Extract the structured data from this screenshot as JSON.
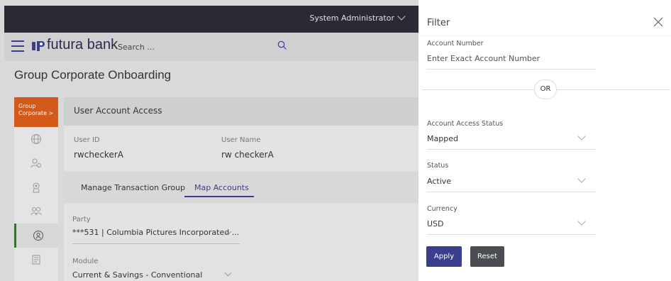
{
  "topbar": {
    "user_label": "System Administrator"
  },
  "header": {
    "brand": "futura bank",
    "search_placeholder": "Search ..."
  },
  "page": {
    "title": "Group Corporate Onboarding"
  },
  "leftnav": {
    "group_label_line1": "Group",
    "group_label_line2": "Corporate",
    "group_chevron": ">"
  },
  "content": {
    "section_title": "User Account Access",
    "user_id_label": "User ID",
    "user_id_value": "rwcheckerA",
    "user_name_label": "User Name",
    "user_name_value": "rw checkerA",
    "tabs": [
      {
        "label": "Manage Transaction Group"
      },
      {
        "label": "Map Accounts"
      }
    ],
    "party_label": "Party",
    "party_value": "***531 | Columbia Pictures Incorporated ...",
    "module_label": "Module",
    "module_value": "Current & Savings - Conventional"
  },
  "filter": {
    "title": "Filter",
    "account_number_label": "Account Number",
    "account_number_placeholder": "Enter Exact Account Number",
    "or_label": "OR",
    "access_status_label": "Account Access Status",
    "access_status_value": "Mapped",
    "status_label": "Status",
    "status_value": "Active",
    "currency_label": "Currency",
    "currency_value": "USD",
    "apply_label": "Apply",
    "reset_label": "Reset"
  },
  "colors": {
    "accent": "#3b3e8f",
    "brand_orange": "#d35a1a",
    "topbar": "#292a33"
  }
}
